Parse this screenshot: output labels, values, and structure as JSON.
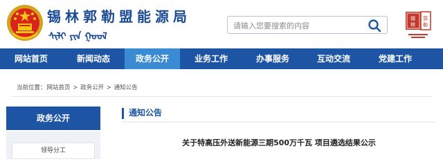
{
  "header": {
    "site_title": "锡林郭勒盟能源局",
    "mongolian_title": "ᠰᠢᠯᠢ ᠶᠢᠨ ᠭᠣᠣᠯ",
    "search": {
      "placeholder": "请输入您要搜索的内容"
    },
    "seal_text": "锡林郭勒"
  },
  "nav": {
    "items": [
      "网站首页",
      "新闻动态",
      "政务公开",
      "业务工作",
      "办事服务",
      "互动交流",
      "党建工作"
    ],
    "active": "政务公开"
  },
  "breadcrumb": {
    "prefix": "当前位置：",
    "items": [
      "网站首页",
      "政务公开",
      "通知公告"
    ],
    "separator": " > "
  },
  "sidebar": {
    "heading": "政务公开",
    "items": [
      "领导分工"
    ]
  },
  "content": {
    "section_title": "通知公告",
    "article_title": "关于特高压外送新能源三期500万千瓦 项目遴选结果公示"
  },
  "colors": {
    "primary": "#1d55a4",
    "nav_active": "#3a8bd3",
    "title_text": "#1a4b94"
  }
}
